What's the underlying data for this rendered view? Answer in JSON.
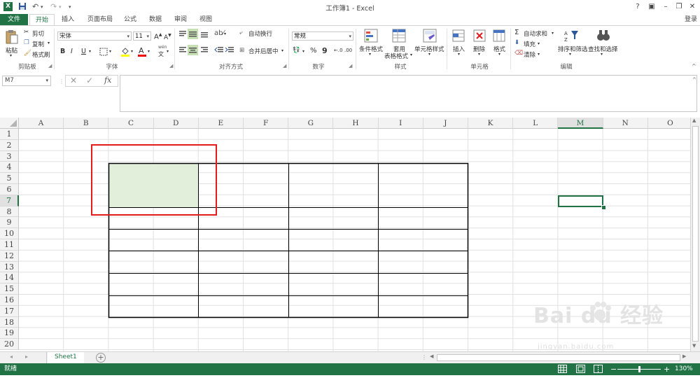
{
  "window": {
    "title": "工作簿1 - Excel",
    "help": "?",
    "minimize": "–",
    "restore": "❐",
    "close": "✕",
    "ribbon_options": "▣"
  },
  "tabs": [
    {
      "label": "文件"
    },
    {
      "label": "开始"
    },
    {
      "label": "插入"
    },
    {
      "label": "页面布局"
    },
    {
      "label": "公式"
    },
    {
      "label": "数据"
    },
    {
      "label": "审阅"
    },
    {
      "label": "视图"
    }
  ],
  "signin": "登录",
  "ribbon": {
    "clipboard": {
      "paste": "粘贴",
      "cut": "剪切",
      "copy": "复制",
      "format_painter": "格式刷",
      "label": "剪贴板"
    },
    "font": {
      "font_name": "宋体",
      "font_size": "11",
      "grow": "A",
      "shrink": "A",
      "bold": "B",
      "italic": "I",
      "underline": "U",
      "label": "字体",
      "phonetic": "wén"
    },
    "alignment": {
      "wrap": "自动换行",
      "merge": "合并后居中",
      "label": "对齐方式"
    },
    "number": {
      "format": "常规",
      "percent": "%",
      "comma": "9",
      "inc": "←.0",
      "dec": ".00",
      "label": "数字"
    },
    "styles": {
      "conditional": "条件格式",
      "table_top": "套用",
      "table_bottom": "表格格式",
      "cell_styles": "单元格样式",
      "label": "样式"
    },
    "cells": {
      "insert": "插入",
      "delete": "删除",
      "format": "格式",
      "label": "单元格"
    },
    "editing": {
      "autosum": "自动求和",
      "fill": "填充",
      "clear": "清除",
      "sort": "排序和筛选",
      "find": "查找和选择",
      "label": "编辑"
    }
  },
  "formula_bar": {
    "name_box": "M7",
    "cancel": "✕",
    "enter": "✓",
    "fx": "fx",
    "value": ""
  },
  "grid": {
    "columns": [
      "A",
      "B",
      "C",
      "D",
      "E",
      "F",
      "G",
      "H",
      "I",
      "J",
      "K",
      "L",
      "M",
      "N",
      "O"
    ],
    "rows": [
      "1",
      "2",
      "3",
      "4",
      "5",
      "6",
      "7",
      "8",
      "9",
      "10",
      "11",
      "12",
      "13",
      "14",
      "15",
      "16",
      "17",
      "18",
      "19",
      "20"
    ],
    "selected_cell": "M7"
  },
  "sheets": [
    {
      "name": "Sheet1"
    }
  ],
  "add_sheet": "+",
  "status": {
    "ready": "就绪",
    "zoom": "130%",
    "zoom_minus": "−",
    "zoom_plus": "+"
  },
  "watermark": {
    "brand": "Bai du 经验",
    "url": "jingyan.baidu.com"
  },
  "colors": {
    "accent": "#217346",
    "highlight_fill": "#e2efda",
    "annotation": "#e21b1b"
  }
}
